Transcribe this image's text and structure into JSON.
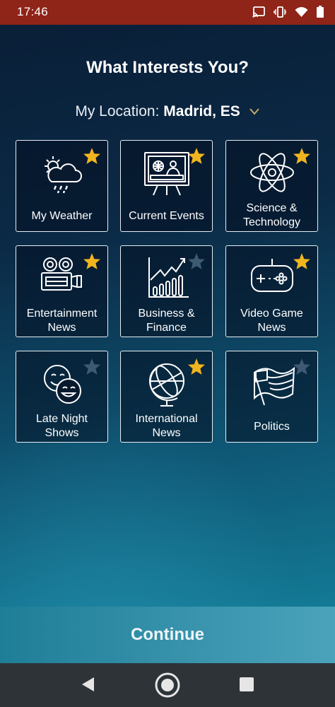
{
  "status_bar": {
    "time": "17:46",
    "icons": [
      "cast-icon",
      "vibrate-icon",
      "wifi-icon",
      "battery-icon"
    ]
  },
  "header": {
    "title": "What Interests You?",
    "location_prefix": "My Location:",
    "location_value": "Madrid, ES"
  },
  "tiles": [
    {
      "label": "My Weather",
      "icon": "weather-icon",
      "starred": true
    },
    {
      "label": "Current Events",
      "icon": "news-anchor-icon",
      "starred": true
    },
    {
      "label": "Science & Technology",
      "icon": "atom-icon",
      "starred": true
    },
    {
      "label": "Entertainment News",
      "icon": "movie-camera-icon",
      "starred": true
    },
    {
      "label": "Business & Finance",
      "icon": "bar-chart-icon",
      "starred": false
    },
    {
      "label": "Video Game News",
      "icon": "gamepad-icon",
      "starred": true
    },
    {
      "label": "Late Night Shows",
      "icon": "smiley-faces-icon",
      "starred": false
    },
    {
      "label": "International News",
      "icon": "globe-icon",
      "starred": true
    },
    {
      "label": "Politics",
      "icon": "flag-icon",
      "starred": false
    }
  ],
  "footer": {
    "continue_label": "Continue"
  },
  "colors": {
    "status_bar": "#8f2418",
    "star_active": "#f0b51e",
    "star_inactive": "#3d5a72",
    "continue_bar": "#3a94ad",
    "nav_bar": "#2e3337"
  }
}
